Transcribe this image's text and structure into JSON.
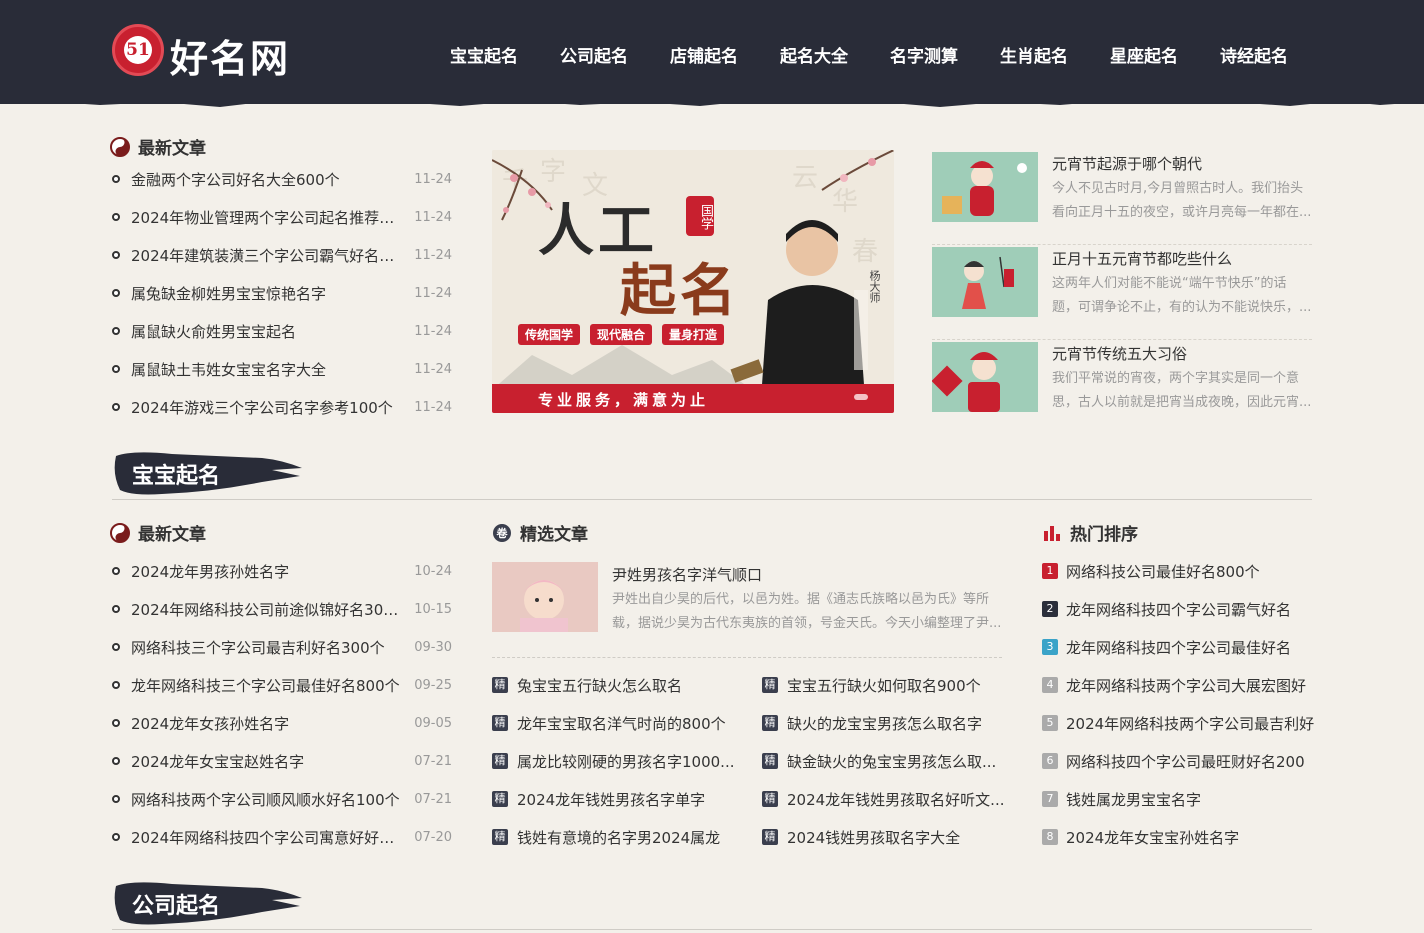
{
  "logo": {
    "badge": "51",
    "text": "好名网"
  },
  "nav": [
    "宝宝起名",
    "公司起名",
    "店铺起名",
    "起名大全",
    "名字测算",
    "生肖起名",
    "星座起名",
    "诗经起名"
  ],
  "top_latest": {
    "heading": "最新文章",
    "items": [
      {
        "title": "金融两个字公司好名大全600个",
        "date": "11-24"
      },
      {
        "title": "2024年物业管理两个字公司起名推荐2...",
        "date": "11-24"
      },
      {
        "title": "2024年建筑装潢三个字公司霸气好名1...",
        "date": "11-24"
      },
      {
        "title": "属兔缺金柳姓男宝宝惊艳名字",
        "date": "11-24"
      },
      {
        "title": "属鼠缺火俞姓男宝宝起名",
        "date": "11-24"
      },
      {
        "title": "属鼠缺土韦姓女宝宝名字大全",
        "date": "11-24"
      },
      {
        "title": "2024年游戏三个字公司名字参考100个",
        "date": "11-24"
      }
    ]
  },
  "banner": {
    "line1": "人工",
    "line2": "起名",
    "seal": "国学",
    "tags": [
      "传统国学",
      "现代融合",
      "量身打造"
    ],
    "footer": "专业服务，满意为止",
    "signature": "杨大师",
    "colors": {
      "red": "#c8202f",
      "ink": "#2b2b2b"
    }
  },
  "side_news": [
    {
      "title": "元宵节起源于哪个朝代",
      "desc": "今人不见古时月,今月曾照古时人。我们抬头看向正月十五的夜空，或许月亮每一年都在..."
    },
    {
      "title": "正月十五元宵节都吃些什么",
      "desc": "这两年人们对能不能说“端午节快乐”的话题，可谓争论不止，有的认为不能说快乐，..."
    },
    {
      "title": "元宵节传统五大习俗",
      "desc": "我们平常说的宵夜，两个字其实是同一个意思，古人以前就是把宵当成夜晚，因此元宵..."
    }
  ],
  "section1": {
    "label": "宝宝起名"
  },
  "section2": {
    "label": "公司起名"
  },
  "latest2": {
    "heading": "最新文章",
    "items": [
      {
        "title": "2024龙年男孩孙姓名字",
        "date": "10-24"
      },
      {
        "title": "2024年网络科技公司前途似锦好名300个",
        "date": "10-15"
      },
      {
        "title": "网络科技三个字公司最吉利好名300个",
        "date": "09-30"
      },
      {
        "title": "龙年网络科技三个字公司最佳好名800个",
        "date": "09-25"
      },
      {
        "title": "2024龙年女孩孙姓名字",
        "date": "09-05"
      },
      {
        "title": "2024龙年女宝宝赵姓名字",
        "date": "07-21"
      },
      {
        "title": "网络科技两个字公司顺风顺水好名100个",
        "date": "07-21"
      },
      {
        "title": "2024年网络科技四个字公司寓意好好名...",
        "date": "07-20"
      }
    ]
  },
  "featured": {
    "heading": "精选文章",
    "main": {
      "title": "尹姓男孩名字洋气顺口",
      "desc": "尹姓出自少昊的后代，以邑为姓。据《通志氏族略以邑为氏》等所载，据说少昊为古代东夷族的首领，号金天氏。今天小编整理了尹..."
    },
    "tag": "精",
    "col1": [
      "兔宝宝五行缺火怎么取名",
      "龙年宝宝取名洋气时尚的800个",
      "属龙比较刚硬的男孩名字1000...",
      "2024龙年钱姓男孩名字单字",
      "钱姓有意境的名字男2024属龙"
    ],
    "col2": [
      "宝宝五行缺火如何取名900个",
      "缺火的龙宝宝男孩怎么取名字",
      "缺金缺火的兔宝宝男孩怎么取...",
      "2024龙年钱姓男孩取名好听文...",
      "2024钱姓男孩取名字大全"
    ]
  },
  "hot": {
    "heading": "热门排序",
    "items": [
      {
        "num": "1",
        "title": "网络科技公司最佳好名800个",
        "color": "#c8202f"
      },
      {
        "num": "2",
        "title": "龙年网络科技四个字公司霸气好名",
        "color": "#2b2f3b"
      },
      {
        "num": "3",
        "title": "龙年网络科技四个字公司最佳好名",
        "color": "#3aa3c8"
      },
      {
        "num": "4",
        "title": "龙年网络科技两个字公司大展宏图好",
        "color": "#aaaaaa"
      },
      {
        "num": "5",
        "title": "2024年网络科技两个字公司最吉利好",
        "color": "#aaaaaa"
      },
      {
        "num": "6",
        "title": "网络科技四个字公司最旺财好名200",
        "color": "#aaaaaa"
      },
      {
        "num": "7",
        "title": "钱姓属龙男宝宝名字",
        "color": "#aaaaaa"
      },
      {
        "num": "8",
        "title": "2024龙年女宝宝孙姓名字",
        "color": "#aaaaaa"
      }
    ]
  }
}
